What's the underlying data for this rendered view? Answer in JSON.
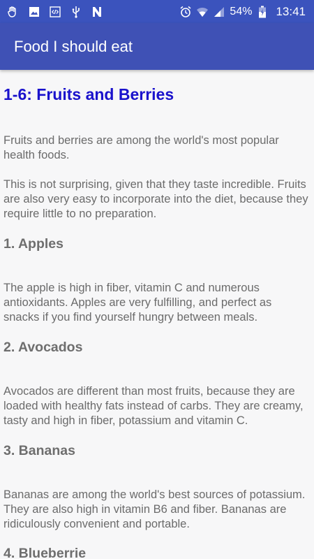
{
  "status_bar": {
    "battery": "54%",
    "time": "13:41",
    "left_icons": [
      "hand-icon",
      "image-icon",
      "code-icon",
      "usb-icon",
      "n-icon"
    ],
    "right_icons": [
      "alarm-icon",
      "wifi-icon",
      "signal-icon",
      "battery-icon"
    ]
  },
  "app_bar": {
    "title": "Food I should eat"
  },
  "content": {
    "section_title": "1-6: Fruits and Berries",
    "intro_1": "Fruits and berries are among the world's most popular health foods.",
    "intro_2": "This is not surprising, given that they taste incredible. Fruits are also very easy to incorporate into the diet, because they require little to no preparation.",
    "items": [
      {
        "heading": "1. Apples",
        "text": "The apple is high in fiber, vitamin C and numerous antioxidants. Apples are very fulfilling, and perfect as snacks if you find yourself hungry between meals."
      },
      {
        "heading": "2. Avocados",
        "text": "Avocados are different than most fruits, because they are loaded with healthy fats instead of carbs. They are creamy, tasty and high in fiber, potassium and vitamin C."
      },
      {
        "heading": "3. Bananas",
        "text": "Bananas are among the world's best sources of potassium. They are also high in vitamin B6 and fiber. Bananas are ridiculously convenient and portable."
      },
      {
        "heading": "4. Blueberrie",
        "text": ""
      }
    ]
  },
  "colors": {
    "status_bar": "#3b53bd",
    "app_bar": "#3f51b5",
    "section_title": "#1a12cc",
    "body_text": "#6b6b6b",
    "background": "#f7f7f8"
  }
}
